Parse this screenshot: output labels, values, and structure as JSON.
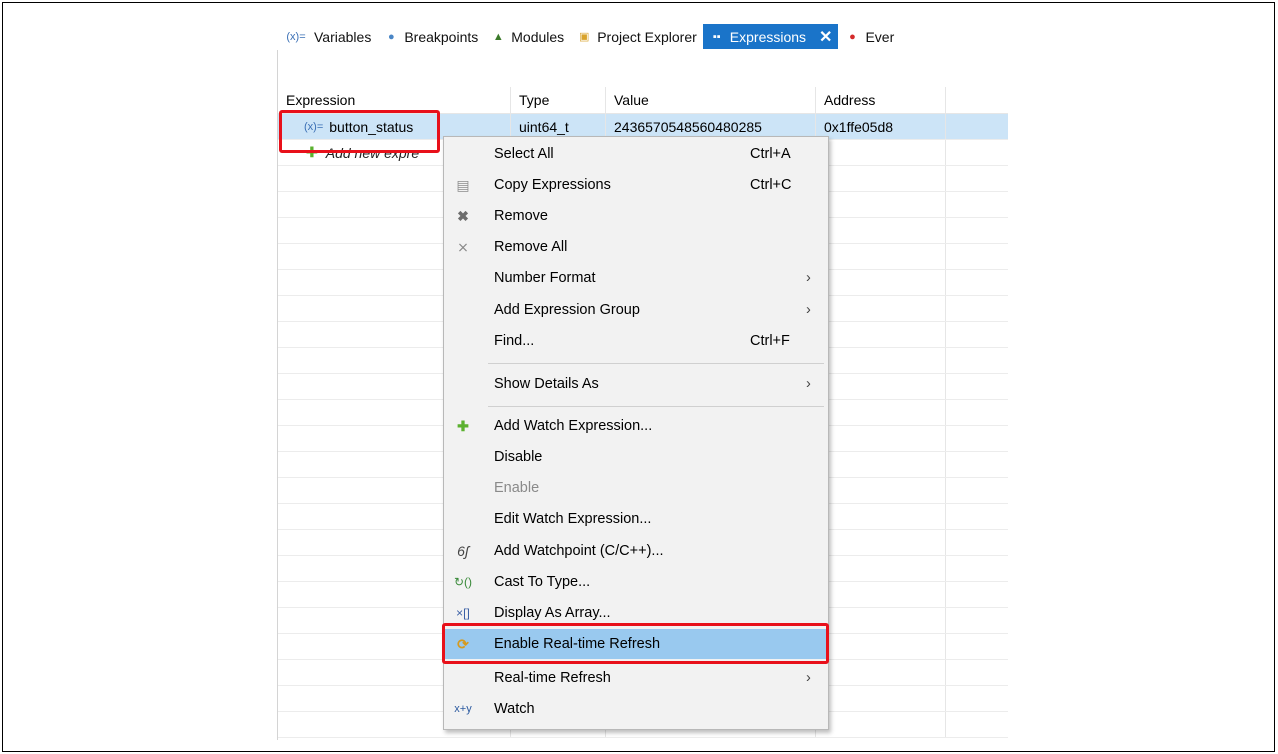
{
  "tabs": [
    {
      "icon": "(x)=",
      "label": "Variables",
      "active": false
    },
    {
      "icon": "●",
      "label": "Breakpoints",
      "active": false
    },
    {
      "icon": "▲",
      "label": "Modules",
      "active": false
    },
    {
      "icon": "▣",
      "label": "Project Explorer",
      "active": false
    },
    {
      "icon": "▪▪",
      "label": "Expressions",
      "active": true,
      "close": "✕"
    },
    {
      "icon": "●",
      "label": "Ever",
      "active": false
    }
  ],
  "table": {
    "headers": [
      "Expression",
      "Type",
      "Value",
      "Address"
    ],
    "rows": [
      {
        "icon": "(x)=",
        "expression": "button_status",
        "type": "uint64_t",
        "value": "2436570548560480285",
        "address": "0x1ffe05d8"
      }
    ],
    "add_new": "Add new expre"
  },
  "menu": {
    "items": [
      {
        "label": "Select All",
        "shortcut": "Ctrl+A",
        "icon": ""
      },
      {
        "label": "Copy Expressions",
        "shortcut": "Ctrl+C",
        "icon": "copy-icon"
      },
      {
        "label": "Remove",
        "shortcut": "",
        "icon": "remove-icon"
      },
      {
        "label": "Remove All",
        "shortcut": "",
        "icon": "remove-all-icon"
      },
      {
        "label": "Number Format",
        "arrow": "›"
      },
      {
        "label": "Add Expression Group",
        "arrow": "›"
      },
      {
        "label": "Find...",
        "shortcut": "Ctrl+F"
      },
      {
        "label": "Show Details As",
        "arrow": "›"
      },
      {
        "label": "Add Watch Expression...",
        "icon": "add-icon"
      },
      {
        "label": "Disable"
      },
      {
        "label": "Enable",
        "disabled": true
      },
      {
        "label": "Edit Watch Expression..."
      },
      {
        "label": "Add Watchpoint (C/C++)...",
        "icon": "watchpoint-icon"
      },
      {
        "label": "Cast To Type...",
        "icon": "cast-icon"
      },
      {
        "label": "Display As Array...",
        "icon": "array-icon"
      },
      {
        "label": "Enable Real-time Refresh",
        "icon": "refresh-icon",
        "highlighted": true
      },
      {
        "label": "Real-time Refresh",
        "arrow": "›"
      },
      {
        "label": "Watch",
        "icon": "watch-icon"
      }
    ]
  },
  "colors": {
    "accent": "#1a74c9",
    "highlight": "#99c9ef",
    "annotation": "#e8101a",
    "selected_row": "#cce4f7"
  }
}
